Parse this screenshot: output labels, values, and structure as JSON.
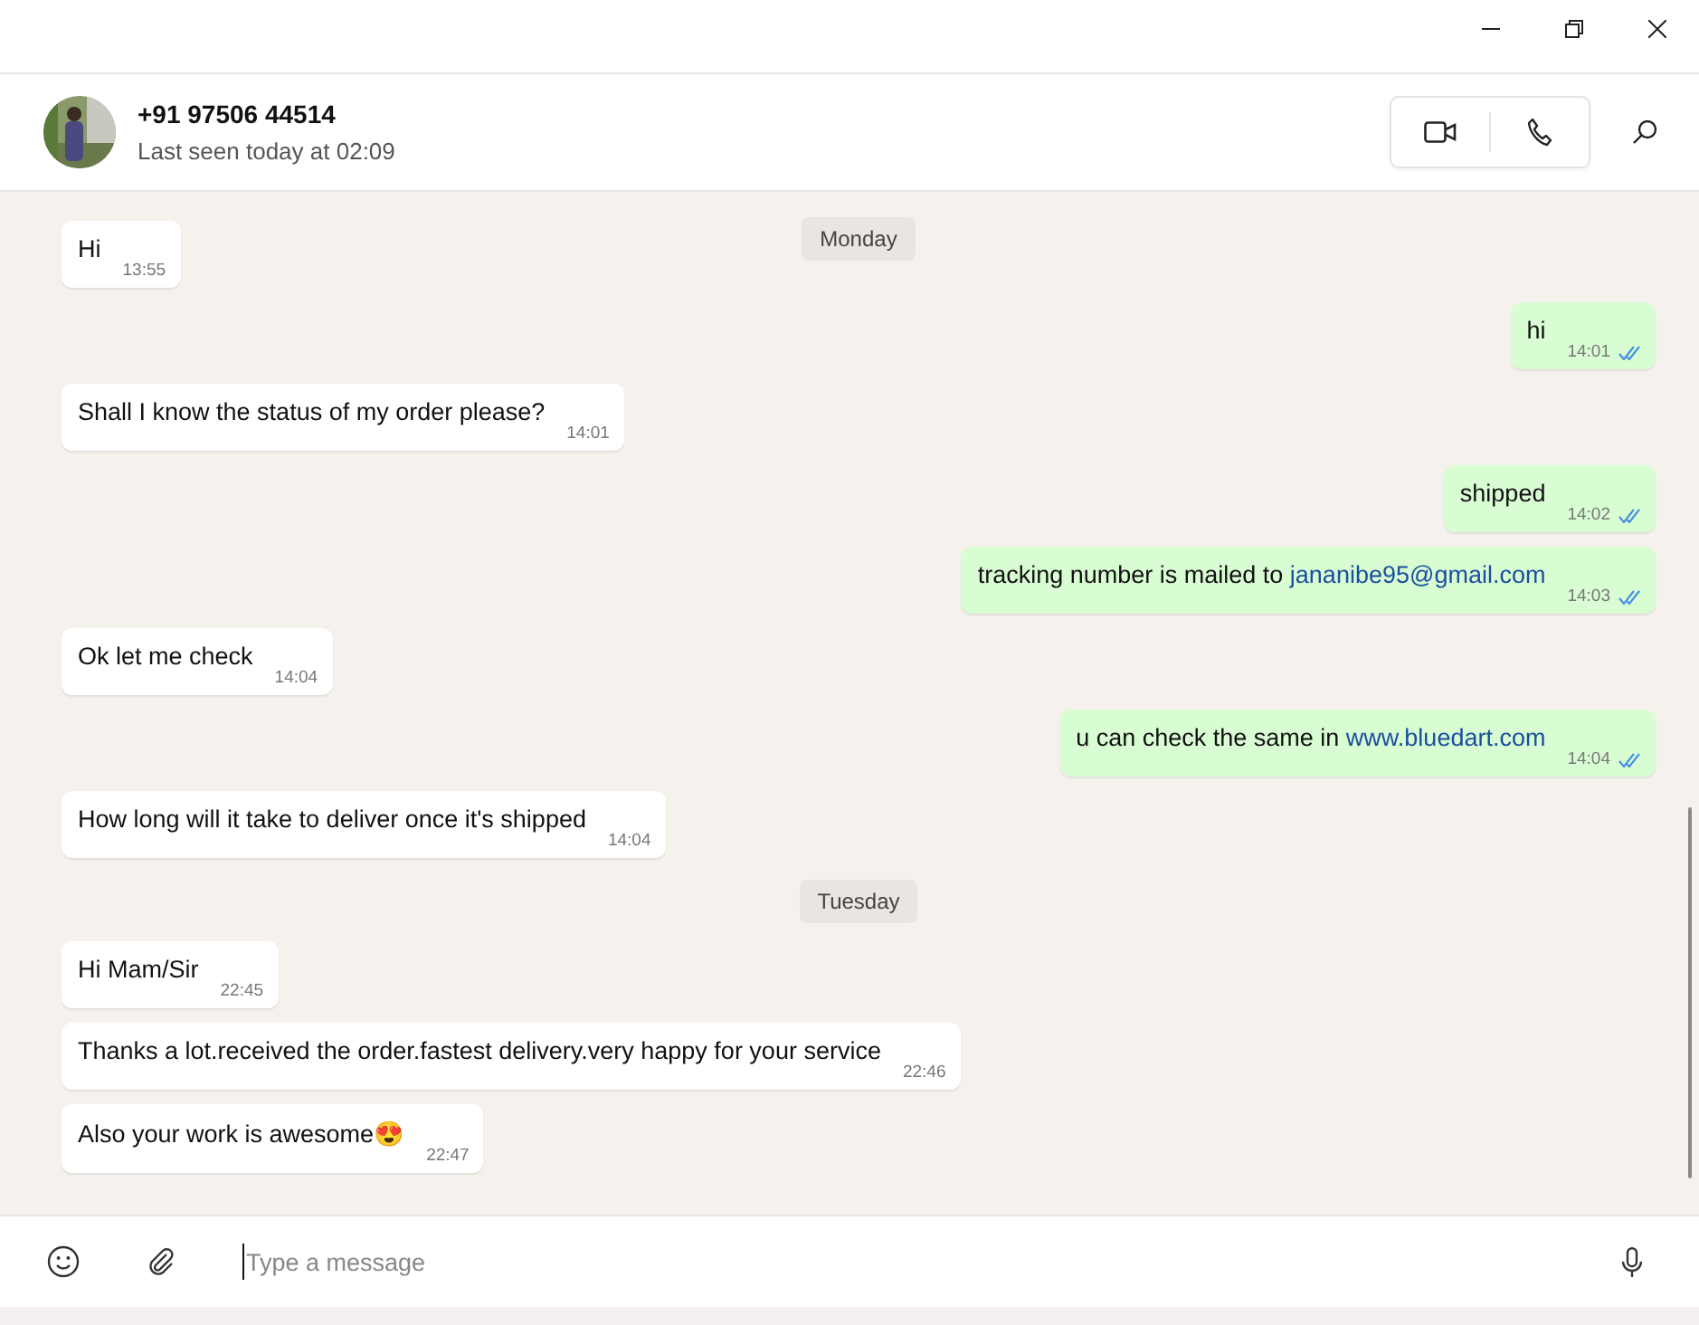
{
  "contact": {
    "name": "+91 97506 44514",
    "status": "Last seen today at 02:09"
  },
  "messages": [
    {
      "kind": "date",
      "text": "Monday"
    },
    {
      "kind": "incoming",
      "text": "Hi",
      "time": "13:55"
    },
    {
      "kind": "outgoing",
      "text": "hi",
      "time": "14:01",
      "read": true
    },
    {
      "kind": "incoming",
      "text": "Shall I know the status of my order please?",
      "time": "14:01"
    },
    {
      "kind": "outgoing",
      "text": "shipped",
      "time": "14:02",
      "read": true
    },
    {
      "kind": "outgoing",
      "text": "tracking number is mailed to",
      "link": "jananibe95@gmail.com",
      "time": "14:03",
      "read": true
    },
    {
      "kind": "incoming",
      "text": "Ok let me check",
      "time": "14:04"
    },
    {
      "kind": "outgoing",
      "text": "u can check the same in",
      "link": "www.bluedart.com",
      "time": "14:04",
      "read": true
    },
    {
      "kind": "incoming",
      "text": "How long will it take to deliver once it's shipped",
      "time": "14:04"
    },
    {
      "kind": "date",
      "text": "Tuesday"
    },
    {
      "kind": "incoming",
      "text": "Hi Mam/Sir",
      "time": "22:45"
    },
    {
      "kind": "incoming",
      "text": "Thanks a lot.received the order.fastest delivery.very happy for your service",
      "time": "22:46"
    },
    {
      "kind": "incoming",
      "text": "Also your work is awesome😍",
      "time": "22:47"
    }
  ],
  "composer": {
    "placeholder": "Type a message"
  }
}
